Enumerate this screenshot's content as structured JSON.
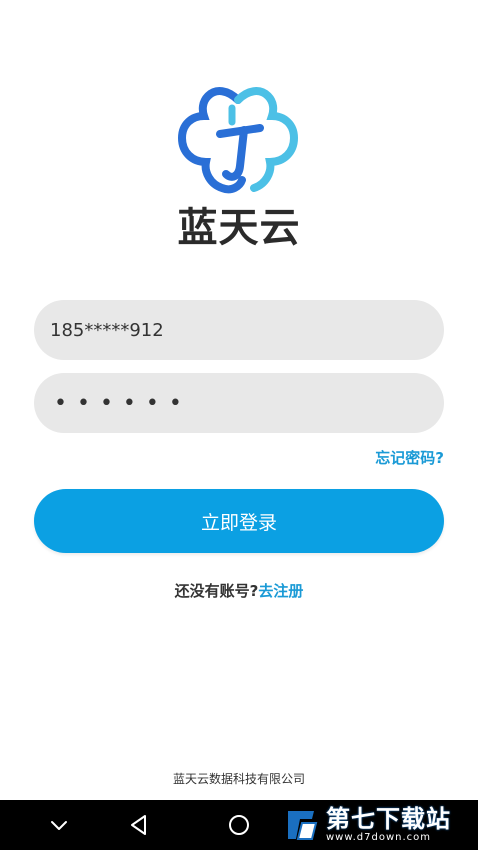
{
  "brand": {
    "name": "蓝天云"
  },
  "login": {
    "phone_value": "185*****912",
    "password_mask": "••••••",
    "forgot_label": "忘记密码?",
    "submit_label": "立即登录",
    "register_prompt": "还没有账号?",
    "register_link": "去注册"
  },
  "footer": {
    "company": "蓝天云数据科技有限公司"
  },
  "navbar": {
    "buttons": [
      "chevron-down-icon",
      "back-triangle-icon",
      "home-circle-icon"
    ]
  },
  "watermark": {
    "title": "第七下载站",
    "url": "www.d7down.com"
  },
  "colors": {
    "accent": "#0ba0e3",
    "link": "#1a9ad6",
    "field_bg": "#e8e8e8",
    "logo_blue": "#2a6fd6",
    "logo_cyan": "#4cc0e6"
  }
}
